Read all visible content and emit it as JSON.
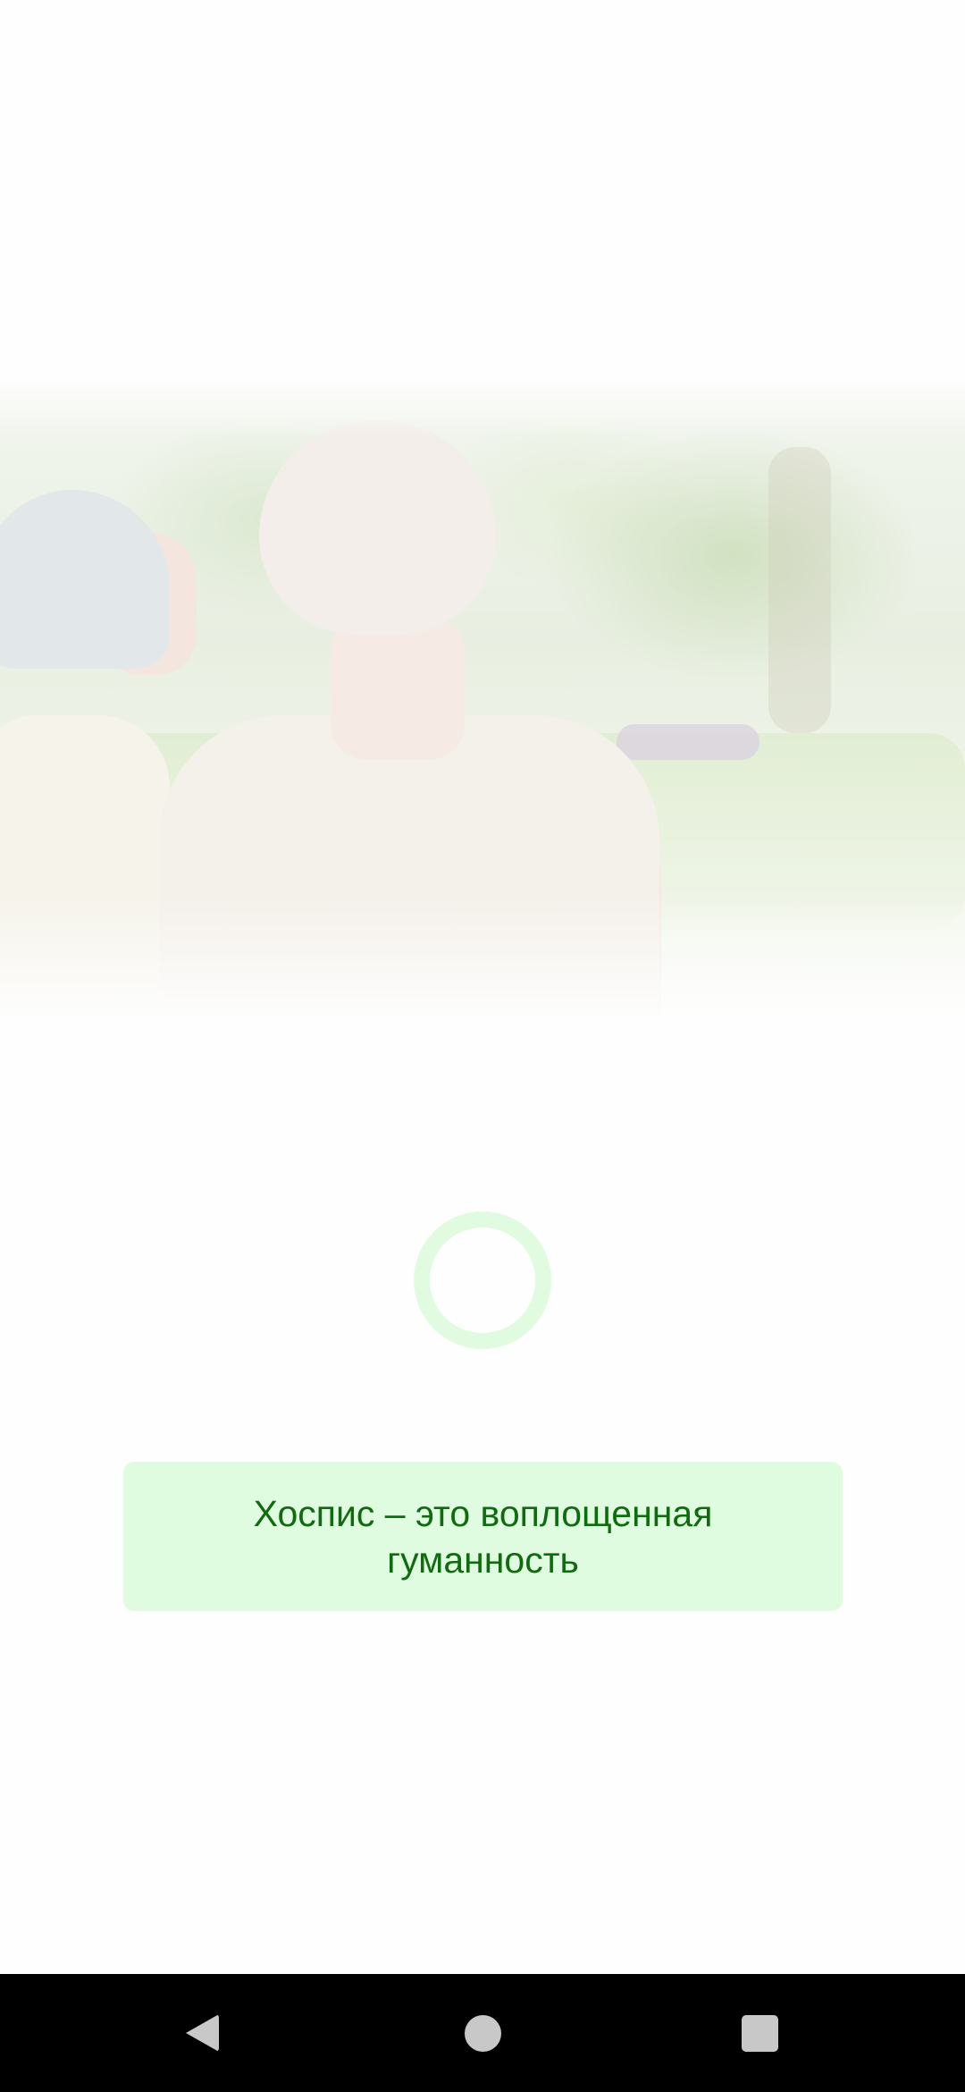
{
  "hero": {
    "description_icon": "hospice-photo-image"
  },
  "loader": {
    "icon": "loading-ring-icon",
    "color": "#e1fbe1"
  },
  "quote": {
    "text": "Хоспис – это воплощенная гуманность",
    "background_color": "#e0fce0",
    "text_color": "#106b10"
  },
  "nav_bar": {
    "back_icon": "back-triangle-icon",
    "home_icon": "home-circle-icon",
    "recents_icon": "recents-square-icon"
  }
}
